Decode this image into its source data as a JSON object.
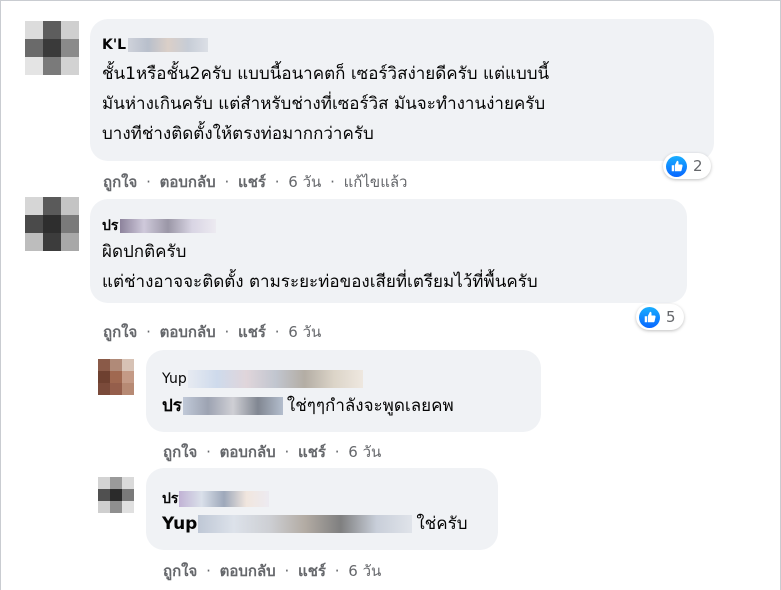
{
  "actions": {
    "like": "ถูกใจ",
    "reply": "ตอบกลับ",
    "share": "แชร์",
    "sep": "·"
  },
  "comments": [
    {
      "name": "K'L",
      "lines": [
        "ชั้น1หรือชั้น2ครับ แบบนี้อนาคตก็ เซอร์วิสง่ายดีครับ แต่แบบนี้",
        "มันห่างเกินครับ แต่สำหรับช่างที่เซอร์วิส มันจะทำงานง่ายครับ",
        "บางทีช่างติดตั้งให้ตรงท่อมากกว่าครับ"
      ],
      "time": "6 วัน",
      "edited": "แก้ไขแล้ว",
      "reactions": "2"
    },
    {
      "name": "ปร",
      "lines": [
        "ผิดปกติครับ",
        "แต่ช่างอาจจะติดตั้ง ตามระยะท่อของเสียที่เตรียมไว้ที่พื้นครับ"
      ],
      "time": "6 วัน",
      "reactions": "5"
    }
  ],
  "replies": [
    {
      "name": "Yup",
      "tag": "ปร",
      "text": "ใช่ๆๆกำลังจะพูดเลยคพ",
      "time": "6 วัน"
    },
    {
      "name": "ปร",
      "tag": "Yup",
      "text": "ใช่ครับ",
      "time": "6 วัน"
    }
  ],
  "colors": {
    "bubble": "#f0f2f5",
    "meta": "#65676b",
    "like": "#0866ff"
  }
}
